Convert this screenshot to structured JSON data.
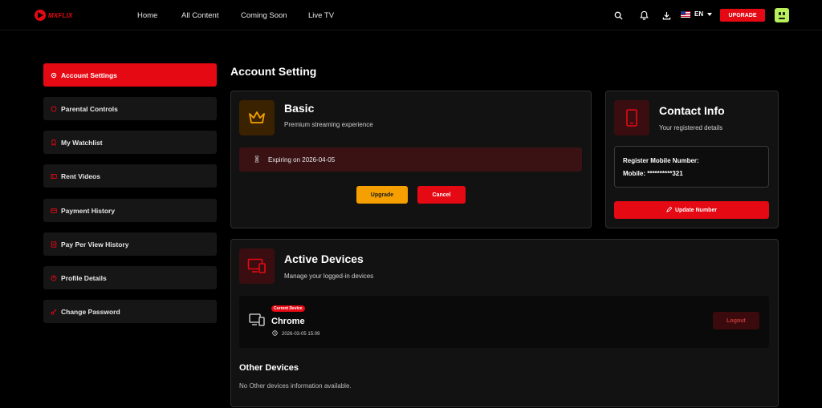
{
  "header": {
    "logo_text": "MXFLIX",
    "nav": [
      "Home",
      "All Content",
      "Coming Soon",
      "Live TV"
    ],
    "language": "EN",
    "upgrade_label": "UPGRADE"
  },
  "sidebar": {
    "items": [
      {
        "label": "Account Settings",
        "icon": "gear-icon",
        "active": true
      },
      {
        "label": "Parental Controls",
        "icon": "shield-icon"
      },
      {
        "label": "My Watchlist",
        "icon": "bookmark-icon"
      },
      {
        "label": "Rent Videos",
        "icon": "film-icon"
      },
      {
        "label": "Payment History",
        "icon": "card-icon"
      },
      {
        "label": "Pay Per View History",
        "icon": "history-icon"
      },
      {
        "label": "Profile Details",
        "icon": "user-icon"
      },
      {
        "label": "Change Password",
        "icon": "key-icon"
      }
    ]
  },
  "main": {
    "title": "Account Setting",
    "plan": {
      "name": "Basic",
      "description": "Premium streaming experience",
      "expiry": "Expiring on 2026-04-05",
      "upgrade_label": "Upgrade",
      "cancel_label": "Cancel"
    },
    "contact": {
      "title": "Contact Info",
      "subtitle": "Your registered details",
      "register_label": "Register Mobile Number:",
      "mobile_line": "Mobile: **********321",
      "update_label": "Update Number"
    },
    "devices": {
      "title": "Active Devices",
      "subtitle": "Manage your logged-in devices",
      "current_badge": "Current Device",
      "current_name": "Chrome",
      "current_time": "2026-03-05 15:09",
      "logout_label": "Logout",
      "other_title": "Other Devices",
      "other_text": "No Other devices information available."
    }
  },
  "colors": {
    "accent": "#e50914",
    "upgrade_button": "#f5a000",
    "background": "#000000",
    "card": "#121212"
  }
}
